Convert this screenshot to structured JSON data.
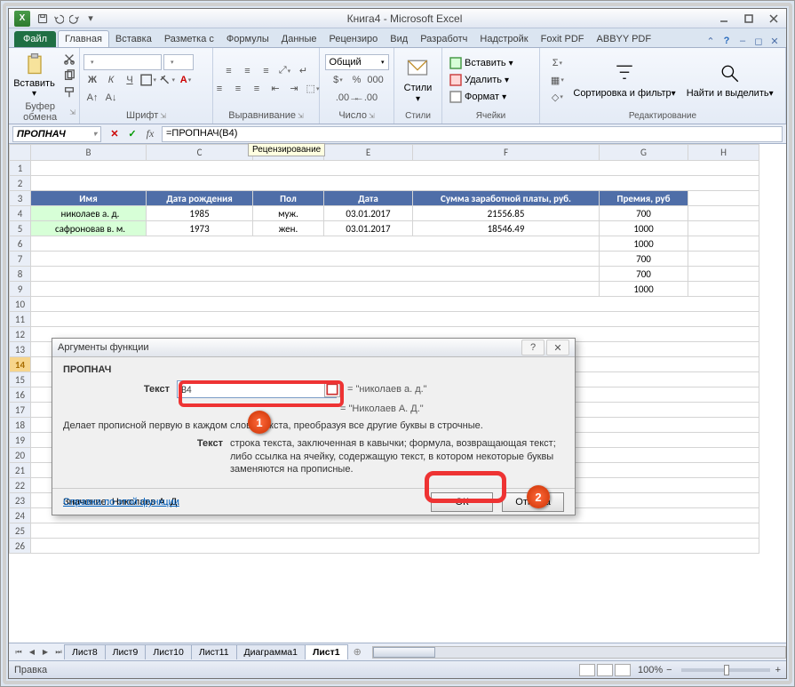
{
  "title": "Книга4 - Microsoft Excel",
  "app_icon_letter": "X",
  "tabs": {
    "file": "Файл",
    "list": [
      "Главная",
      "Вставка",
      "Разметка с",
      "Формулы",
      "Данные",
      "Рецензиро",
      "Вид",
      "Разработч",
      "Надстройк",
      "Foxit PDF",
      "ABBYY PDF"
    ],
    "active_index": 0,
    "tooltip": "Рецензирование"
  },
  "ribbon": {
    "clipboard": {
      "paste": "Вставить",
      "label": "Буфер обмена"
    },
    "font": {
      "label": "Шрифт",
      "name": "",
      "size": ""
    },
    "align": {
      "label": "Выравнивание"
    },
    "number": {
      "label": "Число",
      "format": "Общий"
    },
    "styles": {
      "label": "Стили",
      "btn": "Стили"
    },
    "cells": {
      "label": "Ячейки",
      "insert": "Вставить",
      "delete": "Удалить",
      "format": "Формат"
    },
    "editing": {
      "label": "Редактирование",
      "sort": "Сортировка и фильтр",
      "find": "Найти и выделить"
    }
  },
  "name_box": "ПРОПНАЧ",
  "fb": {
    "cancel": "✕",
    "enter": "✓",
    "fx": "fx"
  },
  "formula": "=ПРОПНАЧ(B4)",
  "columns": [
    "B",
    "C",
    "D",
    "E",
    "F",
    "G",
    "H"
  ],
  "row_ids": [
    "1",
    "2",
    "3",
    "4",
    "5",
    "6",
    "7",
    "8",
    "9",
    "10",
    "11",
    "12",
    "13",
    "14",
    "15",
    "16",
    "17",
    "18",
    "19",
    "20",
    "21",
    "22",
    "23",
    "24",
    "25",
    "26"
  ],
  "active_row": "14",
  "headers": [
    "Имя",
    "Дата рождения",
    "Пол",
    "Дата",
    "Сумма заработной платы, руб.",
    "Премия, руб"
  ],
  "rows": [
    {
      "name": "николаев а. д.",
      "yr": "1985",
      "sex": "муж.",
      "date": "03.01.2017",
      "sal": "21556.85",
      "bon": "700"
    },
    {
      "name": "сафроновав в. м.",
      "yr": "1973",
      "sex": "жен.",
      "date": "03.01.2017",
      "sal": "18546.49",
      "bon": "1000"
    }
  ],
  "bonus_extra": [
    "1000",
    "700",
    "700",
    "1000"
  ],
  "dialog": {
    "title": "Аргументы функции",
    "fn": "ПРОПНАЧ",
    "arg_label": "Текст",
    "arg_value": "B4",
    "eq1": "= \"николаев а. д.\"",
    "eq2": "= \"Николаев А. Д.\"",
    "desc_line": "Делает прописной первую           в каждом слове текста, преобразуя все другие буквы в строчные.",
    "arg_name": "Текст",
    "arg_desc": "строка текста, заключенная в кавычки; формула, возвращающая текст; либо ссылка на ячейку, содержащую текст, в котором некоторые буквы заменяются на прописные.",
    "value_label": "Значение:",
    "value": "Николаев А. Д.",
    "help": "Справка по этой функции",
    "ok": "ОК",
    "cancel": "Отмена"
  },
  "sheets": [
    "Лист8",
    "Лист9",
    "Лист10",
    "Лист11",
    "Диаграмма1",
    "Лист1"
  ],
  "active_sheet": 5,
  "status": {
    "mode": "Правка",
    "zoom": "100%",
    "minus": "−",
    "plus": "+"
  },
  "markers": {
    "m1": "1",
    "m2": "2"
  }
}
